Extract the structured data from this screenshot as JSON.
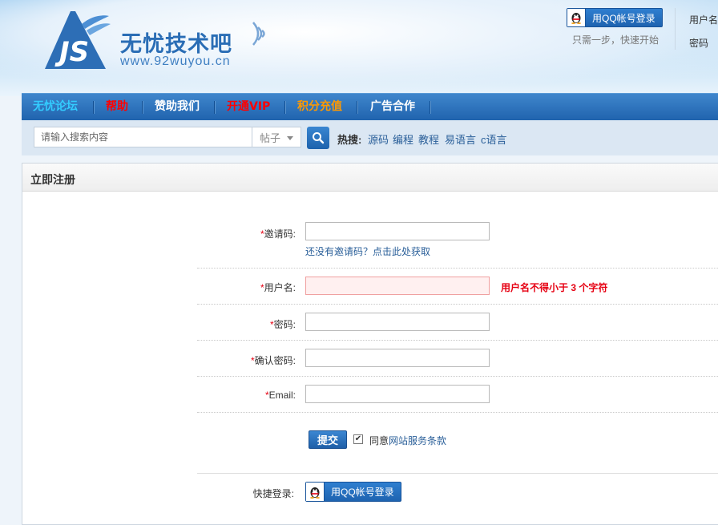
{
  "header": {
    "site_name": "无忧技术吧",
    "site_url": "www.92wuyou.cn",
    "logo_letters": "JS",
    "qq_login_label": "用QQ帐号登录",
    "qq_note": "只需一步，快速开始",
    "username_label": "用户名",
    "password_label": "密码"
  },
  "nav": {
    "items": [
      {
        "label": "无忧论坛",
        "color": "#33ccff"
      },
      {
        "label": "帮助",
        "color": "#ff0000"
      },
      {
        "label": "赞助我们",
        "color": "#ffffff"
      },
      {
        "label": "开通VIP",
        "color": "#ff0000"
      },
      {
        "label": "积分充值",
        "color": "#ff9900"
      },
      {
        "label": "广告合作",
        "color": "#ffffff"
      }
    ]
  },
  "search": {
    "placeholder": "请输入搜索内容",
    "type_selected": "帖子",
    "hot_label": "热搜:",
    "hot_links": [
      "源码",
      "编程",
      "教程",
      "易语言",
      "c语言"
    ]
  },
  "panel": {
    "title": "立即注册"
  },
  "form": {
    "invite": {
      "star": "*",
      "label": "邀请码:",
      "value": "",
      "hint": "还没有邀请码？点击此处获取"
    },
    "username": {
      "star": "*",
      "label": "用户名:",
      "value": "",
      "error": "用户名不得小于 3 个字符"
    },
    "password": {
      "star": "*",
      "label": "密码:",
      "value": ""
    },
    "confirm": {
      "star": "*",
      "label": "确认密码:",
      "value": ""
    },
    "email": {
      "star": "*",
      "label": "Email:",
      "value": ""
    },
    "submit_label": "提交",
    "agree_checked": true,
    "agree_prefix": "同意",
    "agree_link": "网站服务条款",
    "quick_login_label": "快捷登录:",
    "quick_qq_label": "用QQ帐号登录"
  },
  "colors": {
    "brand": "#2a6db5",
    "nav_bg": "#2a6db5",
    "error": "#e60012",
    "link": "#2a5f99"
  }
}
